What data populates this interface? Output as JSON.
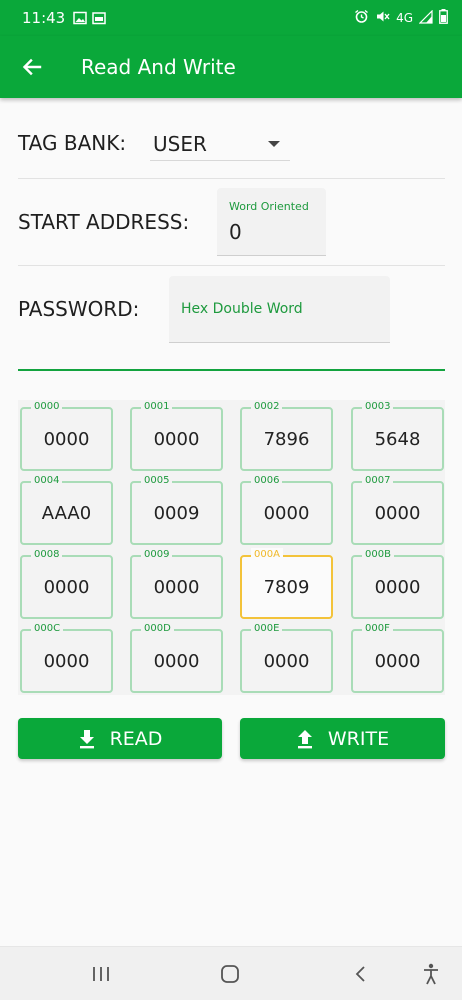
{
  "status": {
    "time": "11:43",
    "network": "4G"
  },
  "appbar": {
    "title": "Read And Write"
  },
  "tag_bank": {
    "label": "TAG BANK:",
    "value": "USER"
  },
  "start_address": {
    "label": "START ADDRESS:",
    "hint": "Word Oriented",
    "value": "0"
  },
  "password": {
    "label": "PASSWORD:",
    "placeholder": "Hex Double Word"
  },
  "cells": [
    {
      "addr": "0000",
      "value": "0000"
    },
    {
      "addr": "0001",
      "value": "0000"
    },
    {
      "addr": "0002",
      "value": "7896"
    },
    {
      "addr": "0003",
      "value": "5648"
    },
    {
      "addr": "0004",
      "value": "AAA0"
    },
    {
      "addr": "0005",
      "value": "0009"
    },
    {
      "addr": "0006",
      "value": "0000"
    },
    {
      "addr": "0007",
      "value": "0000"
    },
    {
      "addr": "0008",
      "value": "0000"
    },
    {
      "addr": "0009",
      "value": "0000"
    },
    {
      "addr": "000A",
      "value": "7809"
    },
    {
      "addr": "000B",
      "value": "0000"
    },
    {
      "addr": "000C",
      "value": "0000"
    },
    {
      "addr": "000D",
      "value": "0000"
    },
    {
      "addr": "000E",
      "value": "0000"
    },
    {
      "addr": "000F",
      "value": "0000"
    }
  ],
  "buttons": {
    "read": "READ",
    "write": "WRITE"
  },
  "colors": {
    "primary": "#0aa83a",
    "accent_active": "#f3c33a",
    "label_green": "#1e9a3e"
  }
}
